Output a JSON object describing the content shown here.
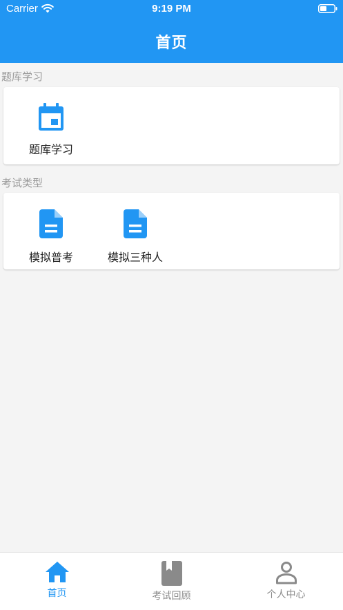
{
  "status_bar": {
    "carrier": "Carrier",
    "time": "9:19 PM"
  },
  "nav": {
    "title": "首页"
  },
  "sections": [
    {
      "label": "题库学习",
      "tiles": [
        {
          "label": "题库学习",
          "icon": "calendar-icon"
        }
      ]
    },
    {
      "label": "考试类型",
      "tiles": [
        {
          "label": "模拟普考",
          "icon": "document-icon"
        },
        {
          "label": "模拟三种人",
          "icon": "document-icon"
        }
      ]
    }
  ],
  "tabbar": {
    "items": [
      {
        "label": "首页",
        "icon": "home-icon",
        "active": true
      },
      {
        "label": "考试回顾",
        "icon": "book-icon",
        "active": false
      },
      {
        "label": "个人中心",
        "icon": "person-icon",
        "active": false
      }
    ]
  },
  "colors": {
    "primary": "#2196f3",
    "inactive": "#8a8a8a",
    "background": "#f4f4f4"
  }
}
